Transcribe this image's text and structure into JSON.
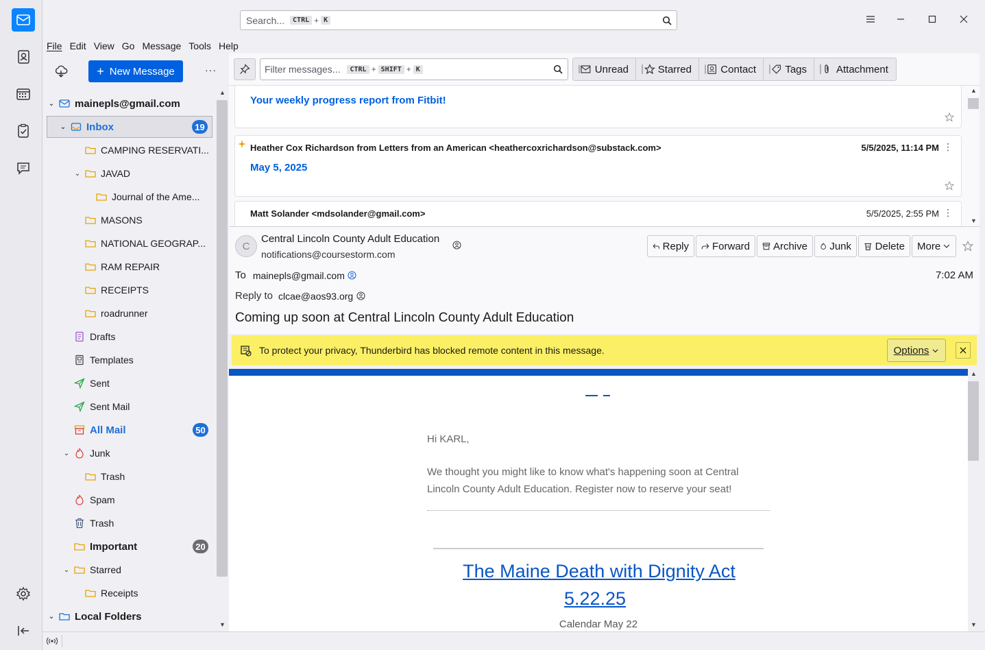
{
  "search": {
    "placeholder": "Search...",
    "key1": "CTRL",
    "plus": "+",
    "key2": "K"
  },
  "menu": [
    "File",
    "Edit",
    "View",
    "Go",
    "Message",
    "Tools",
    "Help"
  ],
  "folder_pane": {
    "new_message": "New Message",
    "more": "···",
    "account": "mainepls@gmail.com",
    "folders": [
      {
        "label": "Inbox",
        "badge": "19"
      },
      {
        "label": "CAMPING RESERVATI..."
      },
      {
        "label": "JAVAD"
      },
      {
        "label": "Journal of the Ame..."
      },
      {
        "label": "MASONS"
      },
      {
        "label": "NATIONAL GEOGRAP..."
      },
      {
        "label": "RAM REPAIR"
      },
      {
        "label": "RECEIPTS"
      },
      {
        "label": "roadrunner"
      },
      {
        "label": "Drafts"
      },
      {
        "label": "Templates"
      },
      {
        "label": "Sent"
      },
      {
        "label": "Sent Mail"
      },
      {
        "label": "All Mail",
        "badge": "50"
      },
      {
        "label": "Junk"
      },
      {
        "label": "Trash"
      },
      {
        "label": "Spam"
      },
      {
        "label": "Trash"
      },
      {
        "label": "Important",
        "badge": "20"
      },
      {
        "label": "Starred"
      },
      {
        "label": "Receipts"
      },
      {
        "label": "Local Folders"
      }
    ]
  },
  "quick_filter": {
    "placeholder": "Filter messages...",
    "k1": "CTRL",
    "k2": "SHIFT",
    "k3": "K",
    "plus": "+",
    "buttons": [
      "Unread",
      "Starred",
      "Contact",
      "Tags",
      "Attachment"
    ]
  },
  "messages": [
    {
      "subject": "Your weekly progress report from Fitbit!"
    },
    {
      "sender": "Heather Cox Richardson from Letters from an American <heathercoxrichardson@substack.com>",
      "date": "5/5/2025, 11:14 PM",
      "subject": "May 5, 2025"
    },
    {
      "sender": "Matt Solander <mdsolander@gmail.com>",
      "date": "5/5/2025, 2:55 PM"
    }
  ],
  "header": {
    "avatar": "C",
    "from_name": "Central Lincoln County Adult Education",
    "from_email": "notifications@coursestorm.com",
    "to_label": "To",
    "to": "mainepls@gmail.com",
    "time": "7:02 AM",
    "reply_to_label": "Reply to",
    "reply_to": "clcae@aos93.org",
    "subject": "Coming up soon at Central Lincoln County Adult Education",
    "actions": [
      "Reply",
      "Forward",
      "Archive",
      "Junk",
      "Delete",
      "More"
    ]
  },
  "notification": {
    "text": "To protect your privacy, Thunderbird has blocked remote content in this message.",
    "options": "Options"
  },
  "body": {
    "greeting": "Hi KARL,",
    "para": "We thought you might like to know what's happening soon at Central Lincoln County Adult Education. Register now to reserve your seat!",
    "event_title_1": "The Maine Death with Dignity Act",
    "event_title_2": "5.22.25",
    "event_date": "Calendar May 22"
  },
  "colors": {
    "accent": "#0061e0",
    "badge": "#1f6fd6",
    "badge_gray": "#6b6b72",
    "notification": "#fbf065",
    "link": "#0a56c4"
  }
}
